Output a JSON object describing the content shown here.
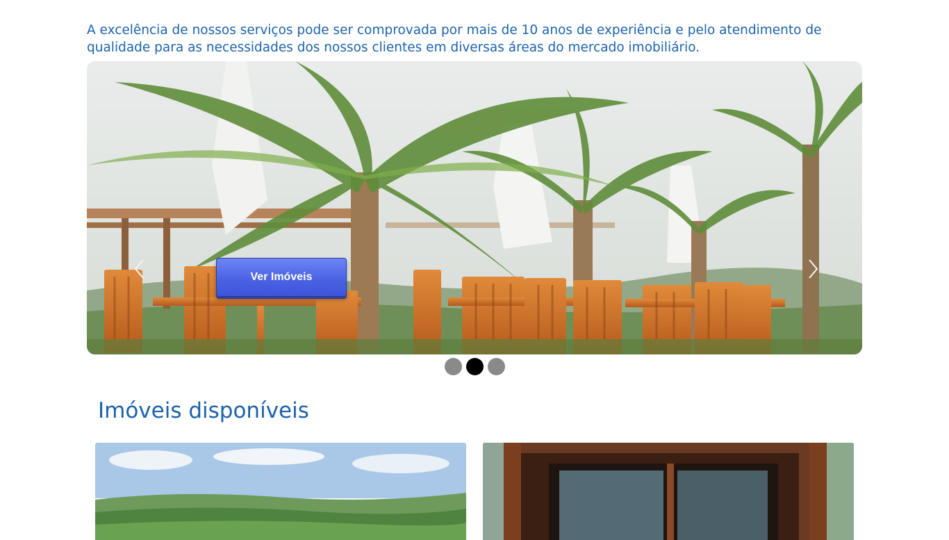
{
  "intro": {
    "text": "A excelência de nossos serviços pode ser comprovada por mais de 10 anos de experiência e pelo atendimento de qualidade para as necessidades dos nossos clientes em diversas áreas do mercado imobiliário."
  },
  "carousel": {
    "cta_label": "Ver Imóveis",
    "prev_icon": "chevron-left-icon",
    "next_icon": "chevron-right-icon",
    "slide_count": 3,
    "active_slide": 2
  },
  "section": {
    "title": "Imóveis disponíveis"
  },
  "colors": {
    "heading": "#1a62ad",
    "button": "#4a63e4",
    "dot_active": "#000000",
    "dot_inactive": "#8a8a8a"
  }
}
